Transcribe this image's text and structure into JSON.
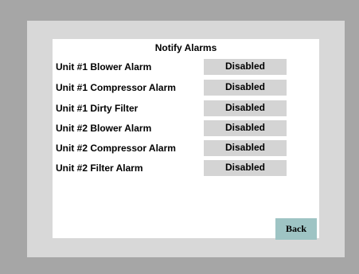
{
  "screen": {
    "title": "Notify Alarms"
  },
  "alarms": [
    {
      "label": "Unit #1 Blower Alarm",
      "status": "Disabled"
    },
    {
      "label": "Unit #1 Compressor Alarm",
      "status": "Disabled"
    },
    {
      "label": "Unit #1 Dirty Filter",
      "status": "Disabled"
    },
    {
      "label": "Unit #2 Blower Alarm",
      "status": "Disabled"
    },
    {
      "label": "Unit #2 Compressor Alarm",
      "status": "Disabled"
    },
    {
      "label": "Unit #2 Filter Alarm",
      "status": "Disabled"
    }
  ],
  "navigation": {
    "back_label": "Back"
  },
  "colors": {
    "bezel_outer": "#a6a6a6",
    "bezel_inner": "#d8d8d8",
    "status_button": "#d4d4d4",
    "back_button": "#9ec4c4"
  }
}
